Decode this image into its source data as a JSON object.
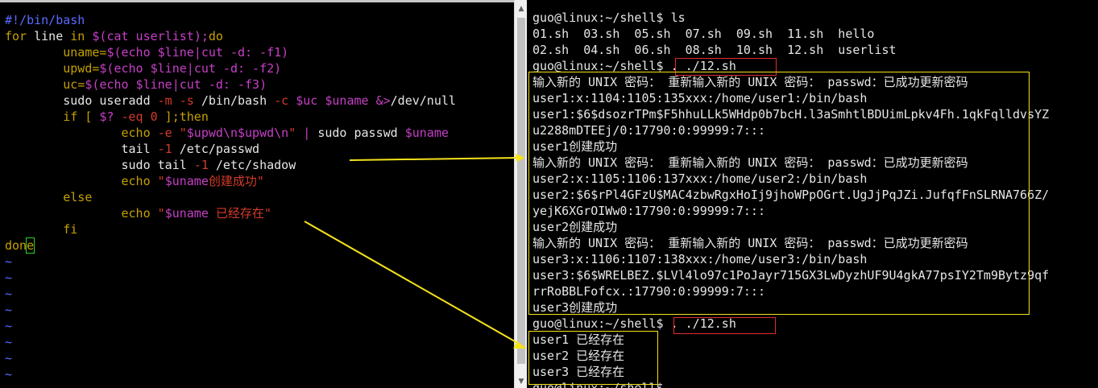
{
  "editor": {
    "lines": [
      {
        "segments": [
          {
            "t": "#!/bin/bash",
            "c": "comment"
          }
        ]
      },
      {
        "segments": [
          {
            "t": "for",
            "c": "kw"
          },
          {
            "t": " line ",
            "c": "cmd"
          },
          {
            "t": "in",
            "c": "kw"
          },
          {
            "t": " $(",
            "c": "var"
          },
          {
            "t": "cat userlist",
            "c": "var"
          },
          {
            "t": ");",
            "c": "var"
          },
          {
            "t": "do",
            "c": "kw"
          }
        ]
      },
      {
        "segments": [
          {
            "t": "        uname=",
            "c": "kw"
          },
          {
            "t": "$(echo $line",
            "c": "var"
          },
          {
            "t": "|",
            "c": "pipe"
          },
          {
            "t": "cut -d: -f1)",
            "c": "var"
          }
        ]
      },
      {
        "segments": [
          {
            "t": "        upwd=",
            "c": "kw"
          },
          {
            "t": "$(echo $line",
            "c": "var"
          },
          {
            "t": "|",
            "c": "pipe"
          },
          {
            "t": "cut -d: -f2)",
            "c": "var"
          }
        ]
      },
      {
        "segments": [
          {
            "t": "        uc=",
            "c": "kw"
          },
          {
            "t": "$(echo $line",
            "c": "var"
          },
          {
            "t": "|",
            "c": "pipe"
          },
          {
            "t": "cut -d: -f3)",
            "c": "var"
          }
        ]
      },
      {
        "segments": [
          {
            "t": "        sudo useradd ",
            "c": "cmd"
          },
          {
            "t": "-m -s",
            "c": "flag"
          },
          {
            "t": " /bin/bash ",
            "c": "cmd"
          },
          {
            "t": "-c",
            "c": "flag"
          },
          {
            "t": " ",
            "c": "cmd"
          },
          {
            "t": "$uc $uname",
            "c": "var"
          },
          {
            "t": " ",
            "c": "cmd"
          },
          {
            "t": "&>",
            "c": "op"
          },
          {
            "t": "/dev/null",
            "c": "cmd"
          }
        ]
      },
      {
        "segments": [
          {
            "t": "        if",
            "c": "kw"
          },
          {
            "t": " [ ",
            "c": "kw"
          },
          {
            "t": "$?",
            "c": "var"
          },
          {
            "t": " -eq ",
            "c": "flag"
          },
          {
            "t": "0",
            "c": "num"
          },
          {
            "t": " ];then",
            "c": "kw"
          }
        ]
      },
      {
        "segments": [
          {
            "t": "                echo ",
            "c": "kw"
          },
          {
            "t": "-e",
            "c": "flag"
          },
          {
            "t": " \"",
            "c": "str"
          },
          {
            "t": "$upwd\\n$upwd\\n",
            "c": "var"
          },
          {
            "t": "\"",
            "c": "str"
          },
          {
            "t": " | ",
            "c": "pipe"
          },
          {
            "t": "sudo passwd ",
            "c": "cmd"
          },
          {
            "t": "$uname",
            "c": "var"
          }
        ]
      },
      {
        "segments": [
          {
            "t": "                tail ",
            "c": "cmd"
          },
          {
            "t": "-1",
            "c": "flag"
          },
          {
            "t": " /etc/passwd",
            "c": "cmd"
          }
        ]
      },
      {
        "segments": [
          {
            "t": "                sudo tail ",
            "c": "cmd"
          },
          {
            "t": "-1",
            "c": "flag"
          },
          {
            "t": " /etc/shadow",
            "c": "cmd"
          }
        ]
      },
      {
        "segments": [
          {
            "t": "                echo ",
            "c": "kw"
          },
          {
            "t": "\"",
            "c": "str"
          },
          {
            "t": "$uname",
            "c": "var"
          },
          {
            "t": "创建成功\"",
            "c": "str"
          }
        ]
      },
      {
        "segments": [
          {
            "t": "        else",
            "c": "kw"
          }
        ]
      },
      {
        "segments": [
          {
            "t": "                echo ",
            "c": "kw"
          },
          {
            "t": "\"",
            "c": "str"
          },
          {
            "t": "$uname",
            "c": "var"
          },
          {
            "t": " 已经存在\"",
            "c": "str"
          }
        ]
      },
      {
        "segments": [
          {
            "t": "        fi",
            "c": "kw"
          }
        ]
      },
      {
        "segments": [
          {
            "t": "don",
            "c": "kw"
          },
          {
            "t": "e",
            "c": "kw",
            "cursor": true
          }
        ]
      },
      {
        "segments": [
          {
            "t": "~",
            "c": "tilde"
          }
        ]
      },
      {
        "segments": [
          {
            "t": "~",
            "c": "tilde"
          }
        ]
      },
      {
        "segments": [
          {
            "t": "~",
            "c": "tilde"
          }
        ]
      },
      {
        "segments": [
          {
            "t": "~",
            "c": "tilde"
          }
        ]
      },
      {
        "segments": [
          {
            "t": "~",
            "c": "tilde"
          }
        ]
      },
      {
        "segments": [
          {
            "t": "~",
            "c": "tilde"
          }
        ]
      },
      {
        "segments": [
          {
            "t": "~",
            "c": "tilde"
          }
        ]
      },
      {
        "segments": [
          {
            "t": "~",
            "c": "tilde"
          }
        ]
      }
    ]
  },
  "terminal": {
    "lines": [
      "guo@linux:~/shell$ ls",
      "01.sh  03.sh  05.sh  07.sh  09.sh  11.sh  hello",
      "02.sh  04.sh  06.sh  08.sh  10.sh  12.sh  userlist",
      "guo@linux:~/shell$ . ./12.sh",
      "输入新的 UNIX 密码： 重新输入新的 UNIX 密码： passwd：已成功更新密码",
      "user1:x:1104:1105:135xxx:/home/user1:/bin/bash",
      "user1:$6$dsozrTPm$F5hhuLLk5WHdp0b7bcH.l3aSmhtlBDUimLpkv4Fh.1qkFqlldvsYZ",
      "u2288mDTEEj/0:17790:0:99999:7:::",
      "user1创建成功",
      "输入新的 UNIX 密码： 重新输入新的 UNIX 密码： passwd：已成功更新密码",
      "user2:x:1105:1106:137xxx:/home/user2:/bin/bash",
      "user2:$6$rPl4GFzU$MAC4zbwRgxHoIj9jhoWPpOGrt.UgJjPqJZi.JufqfFnSLRNA766Z/",
      "yejK6XGrOIWw0:17790:0:99999:7:::",
      "user2创建成功",
      "输入新的 UNIX 密码： 重新输入新的 UNIX 密码： passwd：已成功更新密码",
      "user3:x:1106:1107:138xxx:/home/user3:/bin/bash",
      "user3:$6$WRELBEZ.$LVl4lo97c1PoJayr715GX3LwDyzhUF9U4gkA77psIY2Tm9Bytz9qf",
      "rrRoBBLFofcx.:17790:0:99999:7:::",
      "user3创建成功",
      "guo@linux:~/shell$ . ./12.sh",
      "user1 已经存在",
      "user2 已经存在",
      "user3 已经存在",
      "guo@linux:~/shell$ "
    ]
  },
  "colors": {
    "annotation_red": "#e32b2b",
    "annotation_yellow": "#f5e21b",
    "background": "#000000",
    "text": "#e6e6e6"
  }
}
